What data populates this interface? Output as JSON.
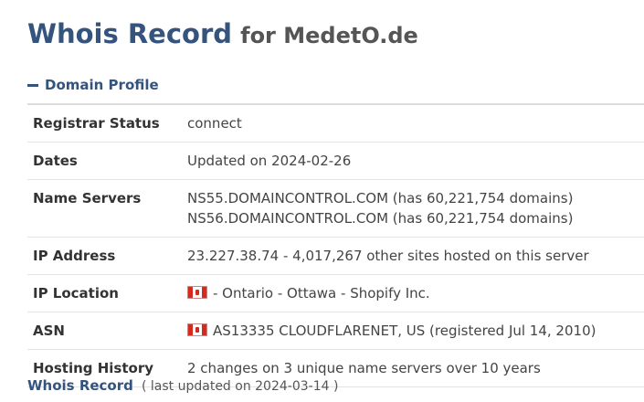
{
  "header": {
    "title": "Whois Record",
    "subtitle": "for MedetO.de"
  },
  "section": {
    "label": "Domain Profile"
  },
  "profile": {
    "registrar_status": {
      "label": "Registrar Status",
      "value": "connect"
    },
    "dates": {
      "label": "Dates",
      "value": "Updated on 2024-02-26"
    },
    "name_servers": {
      "label": "Name Servers",
      "ns1": "NS55.DOMAINCONTROL.COM (has 60,221,754 domains)",
      "ns2": "NS56.DOMAINCONTROL.COM (has 60,221,754 domains)"
    },
    "ip_address": {
      "label": "IP Address",
      "value": "23.227.38.74 - 4,017,267 other sites hosted on this server"
    },
    "ip_location": {
      "label": "IP Location",
      "value": "- Ontario - Ottawa - Shopify Inc.",
      "flag": "canada-flag-icon"
    },
    "asn": {
      "label": "ASN",
      "value": "AS13335 CLOUDFLARENET, US (registered Jul 14, 2010)",
      "flag": "canada-flag-icon"
    },
    "hosting_history": {
      "label": "Hosting History",
      "value": "2 changes on 3 unique name servers over 10 years"
    }
  },
  "footer": {
    "link": "Whois Record",
    "note": "( last updated on 2024-03-14 )"
  },
  "colors": {
    "heading": "#34537d",
    "subtitle": "#555555",
    "text": "#444444",
    "flag_red": "#d52b1e"
  }
}
